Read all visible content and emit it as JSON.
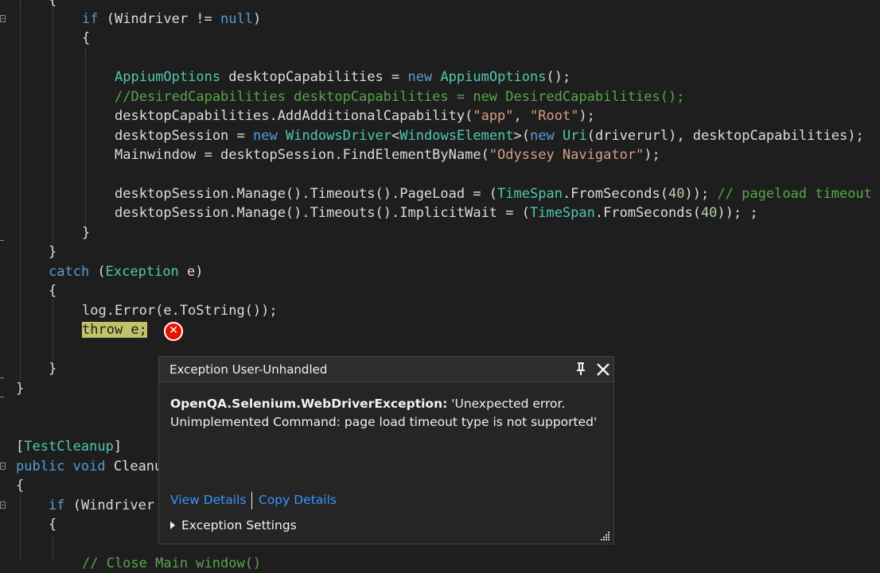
{
  "code": {
    "l0": {
      "kw": "if",
      "p1": " (Windriver != ",
      "kw2": "null",
      "p2": ")"
    },
    "l1": "{",
    "l3": {
      "t1": "AppiumOptions",
      "p1": " desktopCapabilities = ",
      "kw": "new",
      "p2": " ",
      "t2": "AppiumOptions",
      "p3": "();"
    },
    "l4": "//DesiredCapabilities desktopCapabilities = new DesiredCapabilities();",
    "l5": {
      "p1": "desktopCapabilities.AddAdditionalCapability(",
      "s1": "\"app\"",
      "p2": ", ",
      "s2": "\"Root\"",
      "p3": ");"
    },
    "l6": {
      "p1": "desktopSession = ",
      "kw": "new",
      "p2": " ",
      "t1": "WindowsDriver",
      "p3": "<",
      "t2": "WindowsElement",
      "p4": ">(",
      "kw2": "new",
      "p5": " ",
      "t3": "Uri",
      "p6": "(driverurl), desktopCapabilities);"
    },
    "l7": {
      "p1": "Mainwindow = desktopSession.FindElementByName(",
      "s1": "\"Odyssey Navigator\"",
      "p2": ");"
    },
    "l9": {
      "p1": "desktopSession.Manage().Timeouts().PageLoad = (",
      "t1": "TimeSpan",
      "p2": ".FromSeconds(",
      "n1": "40",
      "p3": ")); ",
      "c1": "// pageload timeout"
    },
    "l10": {
      "p1": "desktopSession.Manage().Timeouts().ImplicitWait = (",
      "t1": "TimeSpan",
      "p2": ".FromSeconds(",
      "n1": "40",
      "p3": ")); ;"
    },
    "l11": "}",
    "l12": "}",
    "l13": {
      "kw": "catch",
      "p1": " (",
      "t1": "Exception",
      "p2": " e)"
    },
    "l14": "{",
    "l15": "log.Error(e.ToString());",
    "l16": "throw e;",
    "l18": "}",
    "l19": "}",
    "l22": {
      "p1": "[",
      "a1": "TestCleanup",
      "p2": "]"
    },
    "l23": {
      "kw1": "public",
      "p1": " ",
      "kw2": "void",
      "p2": " Cleanu"
    },
    "l24": "{",
    "l25": {
      "kw": "if",
      "p1": " (Windriver"
    },
    "l26": "{",
    "l28": "// Close Main window()"
  },
  "popup": {
    "title": "Exception User-Unhandled",
    "exception_type": "OpenQA.Selenium.WebDriverException:",
    "exception_message": " 'Unexpected error. Unimplemented Command: page load timeout type is not supported'",
    "view_details": "View Details",
    "copy_details": "Copy Details",
    "exception_settings": "Exception Settings"
  },
  "icons": {
    "error": "error-icon",
    "pin": "pin-icon",
    "close": "close-icon",
    "expand": "expand-triangle-icon",
    "resize": "resize-grip-icon"
  },
  "colors": {
    "background": "#1e1e1e",
    "keyword": "#569cd6",
    "type": "#4ec9b0",
    "string": "#d69d85",
    "comment": "#57a64a",
    "highlight": "#c2c26b",
    "link": "#3794ff",
    "error": "#e51400"
  }
}
